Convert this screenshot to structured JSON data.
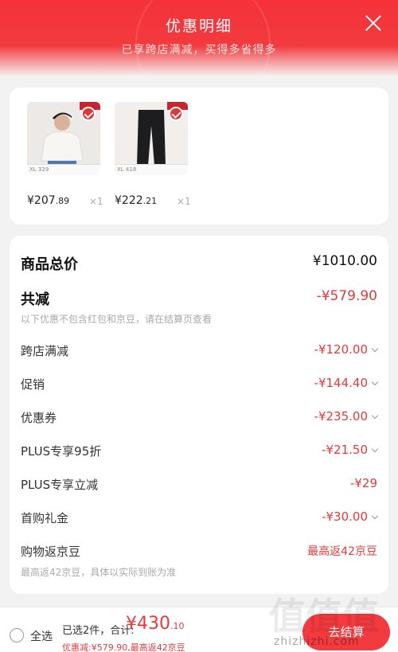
{
  "header": {
    "title": "优惠明细",
    "subtitle": "已享跨店满减，买得多省得多"
  },
  "products": [
    {
      "price_main": "¥207",
      "price_cents": ".89",
      "qty": "×1",
      "tag": "LEVI'S",
      "size_text": "XL 329"
    },
    {
      "price_main": "¥222",
      "price_cents": ".21",
      "qty": "×1",
      "tag": "LEVI'S",
      "size_text": "XL 418"
    }
  ],
  "summary": {
    "total_label": "商品总价",
    "total_value": "¥1010.00",
    "reduce_label": "共减",
    "reduce_value": "-¥579.90",
    "reduce_note": "以下优惠不包含红包和京豆，请在结算页查看"
  },
  "discounts": [
    {
      "label": "跨店满减",
      "value": "-¥120.00"
    },
    {
      "label": "促销",
      "value": "-¥144.40"
    },
    {
      "label": "优惠券",
      "value": "-¥235.00"
    },
    {
      "label": "PLUS专享95折",
      "value": "-¥21.50"
    },
    {
      "label": "PLUS专享立减",
      "value": "-¥29"
    },
    {
      "label": "首购礼金",
      "value": "-¥30.00"
    }
  ],
  "jingdou": {
    "label": "购物返京豆",
    "value": "最高返42京豆",
    "note": "最高返42京豆，具体以实际到账为准"
  },
  "bottom_bar": {
    "select_all": "全选",
    "selected": "已选2件，合计:",
    "total_main": "¥430",
    "total_cents": ".10",
    "savings": "优惠减:¥579.90,最高返42京豆",
    "settle": "去结算"
  },
  "watermark": {
    "glyphs": "值值值",
    "text": "zhizhizhi.com"
  },
  "colors": {
    "accent": "#e4393c",
    "header": "#f5313a"
  }
}
